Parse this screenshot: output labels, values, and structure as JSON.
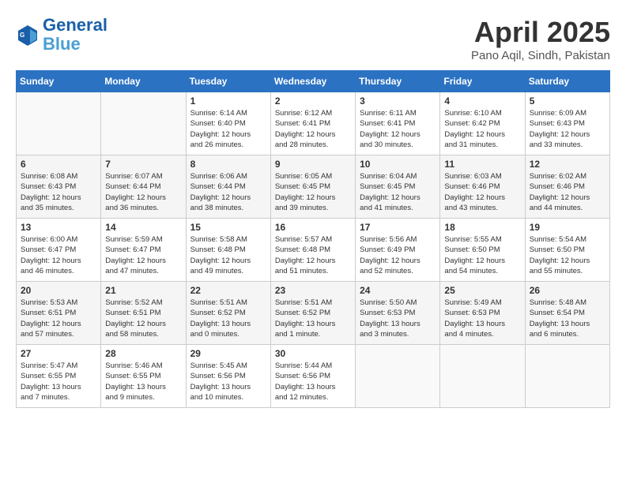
{
  "header": {
    "logo_line1": "General",
    "logo_line2": "Blue",
    "month_title": "April 2025",
    "location": "Pano Aqil, Sindh, Pakistan"
  },
  "weekdays": [
    "Sunday",
    "Monday",
    "Tuesday",
    "Wednesday",
    "Thursday",
    "Friday",
    "Saturday"
  ],
  "weeks": [
    [
      {
        "day": "",
        "info": ""
      },
      {
        "day": "",
        "info": ""
      },
      {
        "day": "1",
        "info": "Sunrise: 6:14 AM\nSunset: 6:40 PM\nDaylight: 12 hours\nand 26 minutes."
      },
      {
        "day": "2",
        "info": "Sunrise: 6:12 AM\nSunset: 6:41 PM\nDaylight: 12 hours\nand 28 minutes."
      },
      {
        "day": "3",
        "info": "Sunrise: 6:11 AM\nSunset: 6:41 PM\nDaylight: 12 hours\nand 30 minutes."
      },
      {
        "day": "4",
        "info": "Sunrise: 6:10 AM\nSunset: 6:42 PM\nDaylight: 12 hours\nand 31 minutes."
      },
      {
        "day": "5",
        "info": "Sunrise: 6:09 AM\nSunset: 6:43 PM\nDaylight: 12 hours\nand 33 minutes."
      }
    ],
    [
      {
        "day": "6",
        "info": "Sunrise: 6:08 AM\nSunset: 6:43 PM\nDaylight: 12 hours\nand 35 minutes."
      },
      {
        "day": "7",
        "info": "Sunrise: 6:07 AM\nSunset: 6:44 PM\nDaylight: 12 hours\nand 36 minutes."
      },
      {
        "day": "8",
        "info": "Sunrise: 6:06 AM\nSunset: 6:44 PM\nDaylight: 12 hours\nand 38 minutes."
      },
      {
        "day": "9",
        "info": "Sunrise: 6:05 AM\nSunset: 6:45 PM\nDaylight: 12 hours\nand 39 minutes."
      },
      {
        "day": "10",
        "info": "Sunrise: 6:04 AM\nSunset: 6:45 PM\nDaylight: 12 hours\nand 41 minutes."
      },
      {
        "day": "11",
        "info": "Sunrise: 6:03 AM\nSunset: 6:46 PM\nDaylight: 12 hours\nand 43 minutes."
      },
      {
        "day": "12",
        "info": "Sunrise: 6:02 AM\nSunset: 6:46 PM\nDaylight: 12 hours\nand 44 minutes."
      }
    ],
    [
      {
        "day": "13",
        "info": "Sunrise: 6:00 AM\nSunset: 6:47 PM\nDaylight: 12 hours\nand 46 minutes."
      },
      {
        "day": "14",
        "info": "Sunrise: 5:59 AM\nSunset: 6:47 PM\nDaylight: 12 hours\nand 47 minutes."
      },
      {
        "day": "15",
        "info": "Sunrise: 5:58 AM\nSunset: 6:48 PM\nDaylight: 12 hours\nand 49 minutes."
      },
      {
        "day": "16",
        "info": "Sunrise: 5:57 AM\nSunset: 6:48 PM\nDaylight: 12 hours\nand 51 minutes."
      },
      {
        "day": "17",
        "info": "Sunrise: 5:56 AM\nSunset: 6:49 PM\nDaylight: 12 hours\nand 52 minutes."
      },
      {
        "day": "18",
        "info": "Sunrise: 5:55 AM\nSunset: 6:50 PM\nDaylight: 12 hours\nand 54 minutes."
      },
      {
        "day": "19",
        "info": "Sunrise: 5:54 AM\nSunset: 6:50 PM\nDaylight: 12 hours\nand 55 minutes."
      }
    ],
    [
      {
        "day": "20",
        "info": "Sunrise: 5:53 AM\nSunset: 6:51 PM\nDaylight: 12 hours\nand 57 minutes."
      },
      {
        "day": "21",
        "info": "Sunrise: 5:52 AM\nSunset: 6:51 PM\nDaylight: 12 hours\nand 58 minutes."
      },
      {
        "day": "22",
        "info": "Sunrise: 5:51 AM\nSunset: 6:52 PM\nDaylight: 13 hours\nand 0 minutes."
      },
      {
        "day": "23",
        "info": "Sunrise: 5:51 AM\nSunset: 6:52 PM\nDaylight: 13 hours\nand 1 minute."
      },
      {
        "day": "24",
        "info": "Sunrise: 5:50 AM\nSunset: 6:53 PM\nDaylight: 13 hours\nand 3 minutes."
      },
      {
        "day": "25",
        "info": "Sunrise: 5:49 AM\nSunset: 6:53 PM\nDaylight: 13 hours\nand 4 minutes."
      },
      {
        "day": "26",
        "info": "Sunrise: 5:48 AM\nSunset: 6:54 PM\nDaylight: 13 hours\nand 6 minutes."
      }
    ],
    [
      {
        "day": "27",
        "info": "Sunrise: 5:47 AM\nSunset: 6:55 PM\nDaylight: 13 hours\nand 7 minutes."
      },
      {
        "day": "28",
        "info": "Sunrise: 5:46 AM\nSunset: 6:55 PM\nDaylight: 13 hours\nand 9 minutes."
      },
      {
        "day": "29",
        "info": "Sunrise: 5:45 AM\nSunset: 6:56 PM\nDaylight: 13 hours\nand 10 minutes."
      },
      {
        "day": "30",
        "info": "Sunrise: 5:44 AM\nSunset: 6:56 PM\nDaylight: 13 hours\nand 12 minutes."
      },
      {
        "day": "",
        "info": ""
      },
      {
        "day": "",
        "info": ""
      },
      {
        "day": "",
        "info": ""
      }
    ]
  ]
}
